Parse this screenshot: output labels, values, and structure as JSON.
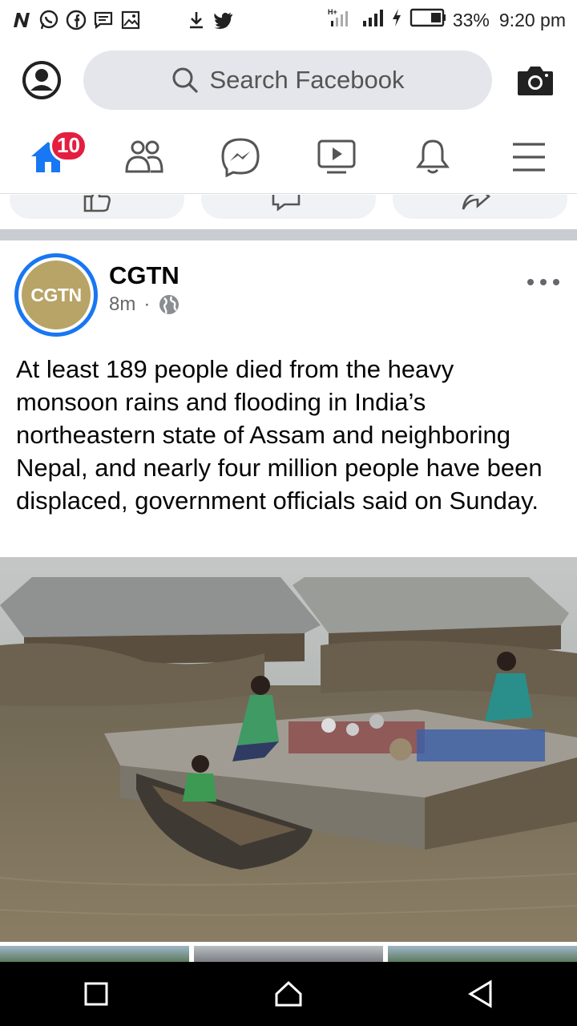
{
  "status_bar": {
    "battery": "33%",
    "time": "9:20 pm",
    "left_icons": [
      "n-icon",
      "whatsapp-icon",
      "facebook-icon",
      "message-icon",
      "gallery-icon",
      "download-icon",
      "twitter-icon"
    ],
    "right_icons": [
      "network-icon",
      "signal-icon",
      "charging-icon",
      "battery-icon"
    ]
  },
  "header": {
    "search_placeholder": "Search Facebook"
  },
  "tabs": {
    "home_badge": "10",
    "items": [
      "home-icon",
      "friends-icon",
      "messenger-icon",
      "watch-icon",
      "notifications-icon",
      "menu-icon"
    ]
  },
  "post": {
    "page_name": "CGTN",
    "avatar_text": "CGTN",
    "time": "8m",
    "separator": "·",
    "text": "At least 189 people died from the heavy monsoon rains and flooding in India’s northeastern state of Assam and neighboring Nepal, and nearly four million people have been displaced, government officials said on Sunday."
  },
  "colors": {
    "accent": "#1877f2",
    "badge": "#e41e3f",
    "search_bg": "#e4e6eb",
    "avatar_gold": "#b8a467"
  }
}
